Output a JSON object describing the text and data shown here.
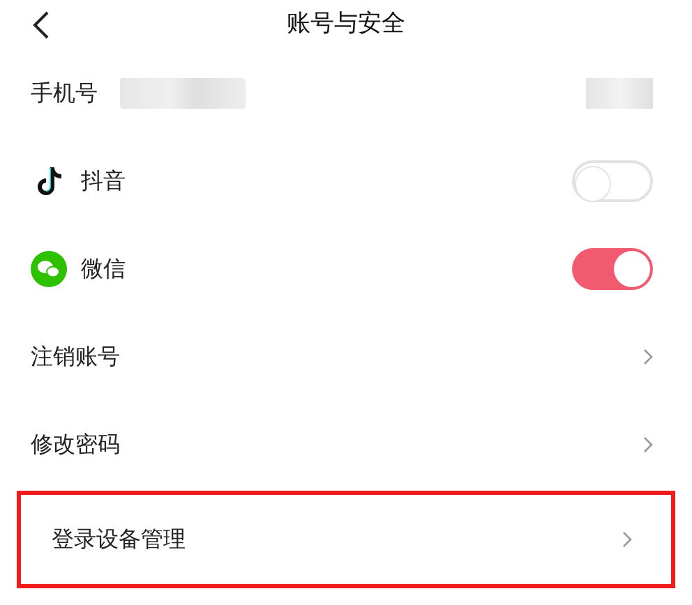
{
  "header": {
    "title": "账号与安全"
  },
  "rows": [
    {
      "kind": "phone",
      "label": "手机号",
      "highlighted": false
    },
    {
      "kind": "toggle",
      "label": "抖音",
      "on": false,
      "highlighted": false
    },
    {
      "kind": "toggle",
      "label": "微信",
      "on": true,
      "highlighted": false
    },
    {
      "kind": "link",
      "label": "注销账号",
      "highlighted": false
    },
    {
      "kind": "link",
      "label": "修改密码",
      "highlighted": false
    },
    {
      "kind": "link",
      "label": "登录设备管理",
      "highlighted": true
    }
  ]
}
